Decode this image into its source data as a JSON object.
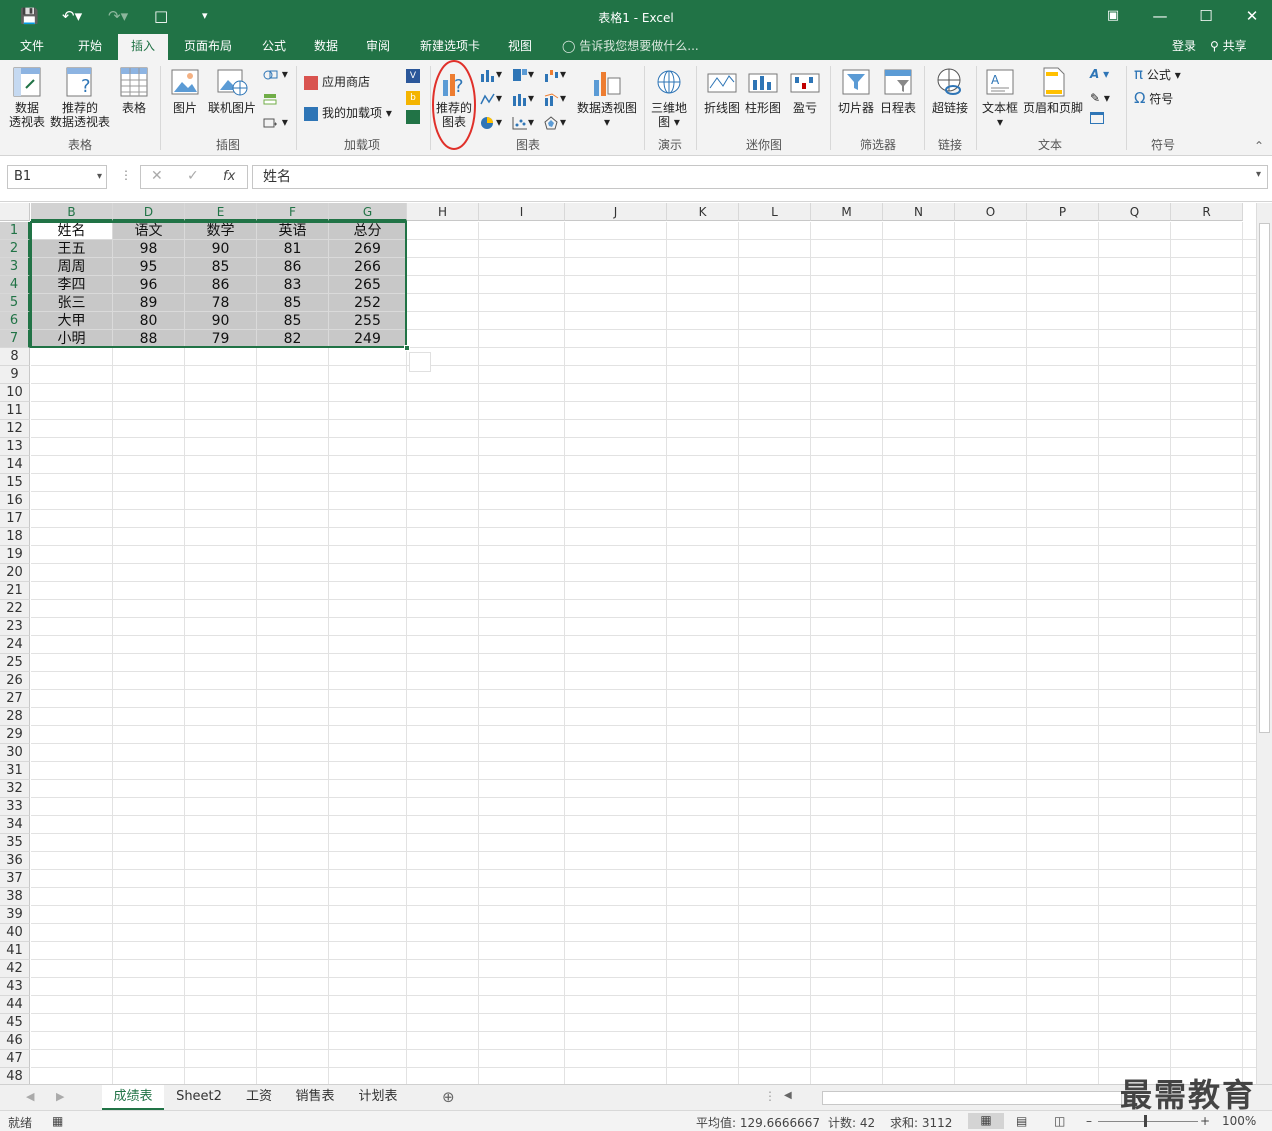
{
  "titlebar": {
    "title": "表格1 - Excel",
    "qa_icons": [
      "save-icon",
      "undo-icon",
      "redo-icon",
      "new-doc-icon",
      "customize-icon"
    ]
  },
  "tabs": [
    "文件",
    "开始",
    "插入",
    "页面布局",
    "公式",
    "数据",
    "审阅",
    "新建选项卡",
    "视图"
  ],
  "active_tab": "插入",
  "tell_me": "告诉我您想要做什么...",
  "login": "登录",
  "share": "共享",
  "ribbon": {
    "pivot": "数据\n透视表",
    "pivot_a": "数据",
    "pivot_b": "透视表",
    "rec_pivot_a": "推荐的",
    "rec_pivot_b": "数据透视表",
    "table": "表格",
    "picture": "图片",
    "online_picture": "联机图片",
    "store": "应用商店",
    "my_addins": "我的加载项",
    "rec_chart_a": "推荐的",
    "rec_chart_b": "图表",
    "pivot_chart": "数据透视图",
    "map3d_a": "三维地",
    "map3d_b": "图",
    "spark_line": "折线图",
    "spark_col": "柱形图",
    "spark_wl": "盈亏",
    "slicer": "切片器",
    "timeline": "日程表",
    "hyperlink": "超链接",
    "textbox": "文本框",
    "header_footer": "页眉和页脚",
    "equation": "公式",
    "symbol": "符号",
    "groups": {
      "tables": "表格",
      "illustrations": "插图",
      "addins": "加载项",
      "charts": "图表",
      "tours": "演示",
      "sparklines": "迷你图",
      "filters": "筛选器",
      "links": "链接",
      "text": "文本",
      "symbols": "符号"
    }
  },
  "formula_bar": {
    "name_box": "B1",
    "formula": "姓名"
  },
  "columns": [
    "B",
    "D",
    "E",
    "F",
    "G",
    "H",
    "I",
    "J",
    "K",
    "L",
    "M",
    "N",
    "O",
    "P",
    "Q",
    "R"
  ],
  "table": {
    "headers": [
      "姓名",
      "语文",
      "数学",
      "英语",
      "总分"
    ],
    "rows": [
      [
        "王五",
        "98",
        "90",
        "81",
        "269"
      ],
      [
        "周周",
        "95",
        "85",
        "86",
        "266"
      ],
      [
        "李四",
        "96",
        "86",
        "83",
        "265"
      ],
      [
        "张三",
        "89",
        "78",
        "85",
        "252"
      ],
      [
        "大甲",
        "80",
        "90",
        "85",
        "255"
      ],
      [
        "小明",
        "88",
        "79",
        "82",
        "249"
      ]
    ]
  },
  "sheets": [
    "成绩表",
    "Sheet2",
    "工资",
    "销售表",
    "计划表"
  ],
  "active_sheet": "成绩表",
  "status": {
    "ready": "就绪",
    "average": "平均值: 129.6666667",
    "count": "计数: 42",
    "sum": "求和: 3112",
    "zoom": "100%"
  },
  "watermark": "最需教育",
  "colors": {
    "accent": "#217346",
    "highlight_circle": "#e0302a"
  }
}
